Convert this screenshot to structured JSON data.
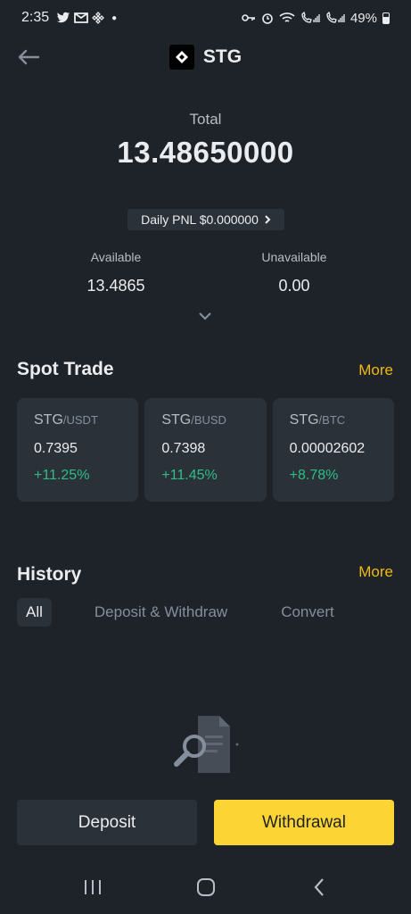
{
  "status_bar": {
    "time": "2:35",
    "battery_percent": "49%",
    "left_icons": [
      "twitter-icon",
      "gmail-icon",
      "binance-icon",
      "dot-icon"
    ],
    "right_icons": [
      "vpn-key-icon",
      "alarm-icon",
      "wifi-icon",
      "call-signal-icon",
      "call-signal-icon",
      "battery-icon"
    ]
  },
  "header": {
    "title": "STG"
  },
  "balance": {
    "total_label": "Total",
    "total_value": "13.48650000",
    "daily_pnl": "Daily PNL $0.000000",
    "available_label": "Available",
    "available_value": "13.4865",
    "unavailable_label": "Unavailable",
    "unavailable_value": "0.00"
  },
  "spot_trade": {
    "title": "Spot Trade",
    "more": "More",
    "pairs": [
      {
        "base": "STG",
        "quote": "/USDT",
        "price": "0.7395",
        "change": "+11.25%"
      },
      {
        "base": "STG",
        "quote": "/BUSD",
        "price": "0.7398",
        "change": "+11.45%"
      },
      {
        "base": "STG",
        "quote": "/BTC",
        "price": "0.00002602",
        "change": "+8.78%"
      }
    ]
  },
  "history": {
    "title": "History",
    "more": "More",
    "tabs": [
      "All",
      "Deposit & Withdraw",
      "Convert"
    ],
    "active_tab": "All"
  },
  "actions": {
    "deposit": "Deposit",
    "withdrawal": "Withdrawal"
  },
  "colors": {
    "background": "#1e2329",
    "card": "#2b3139",
    "accent": "#f0b90b",
    "button_yellow": "#fcd535",
    "positive": "#2ebd85"
  }
}
